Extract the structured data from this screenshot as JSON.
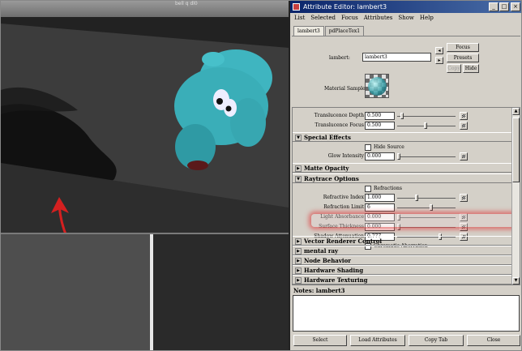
{
  "viewport": {
    "corner_label": "bell q dl0"
  },
  "window": {
    "title": "Attribute Editor: lambert3",
    "minimize": "_",
    "maximize": "□",
    "close": "×"
  },
  "menu": [
    "List",
    "Selected",
    "Focus",
    "Attributes",
    "Show",
    "Help"
  ],
  "tabs": [
    "lambert3",
    "pdPlaceTex1"
  ],
  "header": {
    "node_label": "lambert:",
    "node_value": "lambert3",
    "focus": "Focus",
    "presets": "Presets",
    "copy": "Copy",
    "hide": "Hide",
    "material_sample": "Material Sample"
  },
  "rows": {
    "translucence_depth": {
      "label": "Translucence Depth",
      "value": "0.500"
    },
    "translucence_focus": {
      "label": "Translucence Focus",
      "value": "0.500"
    },
    "hide_source": {
      "label": "Hide Source"
    },
    "glow_intensity": {
      "label": "Glow Intensity",
      "value": "0.000"
    },
    "refractions": {
      "label": "Refractions"
    },
    "refractive_index": {
      "label": "Refractive Index",
      "value": "1.000"
    },
    "refraction_limit": {
      "label": "Refraction Limit",
      "value": "6"
    },
    "light_absorbance": {
      "label": "Light Absorbance",
      "value": "0.000"
    },
    "surface_thickness": {
      "label": "Surface Thickness",
      "value": "0.000"
    },
    "shadow_attenuation": {
      "label": "Shadow Attenuation",
      "value": "0.777"
    },
    "chromatic_aberration": {
      "label": "Chromatic Aberration"
    }
  },
  "sections": {
    "special_effects": "Special Effects",
    "matte_opacity": "Matte Opacity",
    "raytrace_options": "Raytrace Options"
  },
  "collapsed_sections": [
    "Vector Renderer Control",
    "mental ray",
    "Node Behavior",
    "Hardware Shading",
    "Hardware Texturing"
  ],
  "notes": {
    "label": "Notes:  lambert3"
  },
  "bottom_buttons": {
    "select": "Select",
    "load": "Load Attributes",
    "copy_tab": "Copy Tab",
    "close": "Close"
  },
  "slider_levels": {
    "translucence_depth": 0.06,
    "translucence_focus": 0.5,
    "glow_intensity": 0.0,
    "refractive_index": 0.33,
    "refraction_limit": 0.6,
    "light_absorbance": 0.0,
    "surface_thickness": 0.0,
    "shadow_attenuation": 0.78
  },
  "colors": {
    "titlebar": "#0a246a",
    "panel": "#d4d0c8",
    "highlight_glow": "#dc5050",
    "model": "#3fb5c0",
    "annotation_arrow": "#d42020"
  }
}
